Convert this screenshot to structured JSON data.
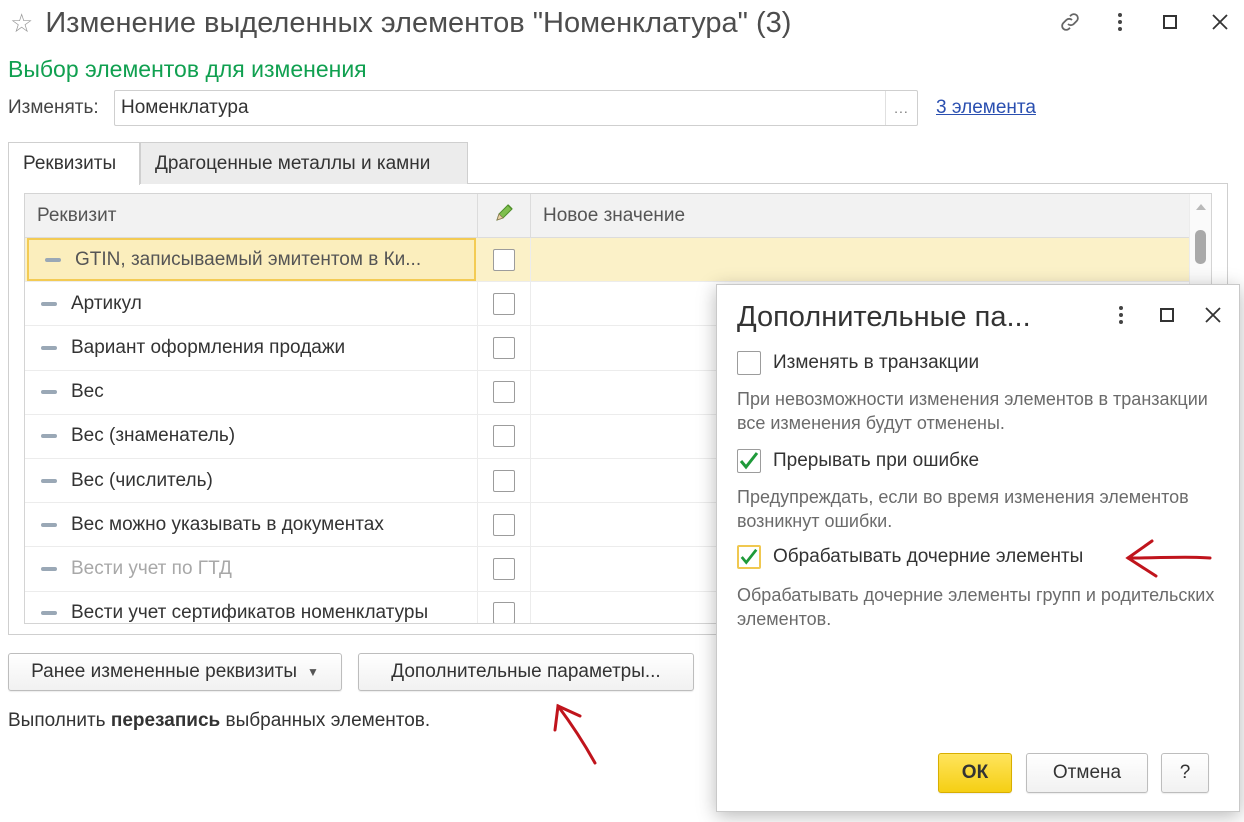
{
  "window": {
    "title": "Изменение выделенных элементов \"Номенклатура\" (3)"
  },
  "section": {
    "title": "Выбор элементов для изменения"
  },
  "change": {
    "label": "Изменять:",
    "value": "Номенклатура",
    "choose_button": "...",
    "count_link": "3 элемента"
  },
  "tabs": [
    {
      "label": "Реквизиты",
      "active": true
    },
    {
      "label": "Драгоценные металлы и камни",
      "active": false
    }
  ],
  "table": {
    "columns": {
      "name": "Реквизит",
      "value": "Новое значение"
    },
    "rows": [
      {
        "label": "GTIN, записываемый эмитентом в Ки..."
      },
      {
        "label": "Артикул"
      },
      {
        "label": "Вариант оформления продажи"
      },
      {
        "label": "Вес"
      },
      {
        "label": "Вес (знаменатель)"
      },
      {
        "label": "Вес (числитель)"
      },
      {
        "label": "Вес можно указывать в документах"
      },
      {
        "label": "Вести учет по ГТД"
      },
      {
        "label": "Вести учет сертификатов номенклатуры"
      }
    ]
  },
  "buttons": {
    "previous": "Ранее измененные реквизиты",
    "more": "Дополнительные параметры..."
  },
  "footer": {
    "before": "Выполнить ",
    "bold": "перезапись",
    "after": " выбранных элементов."
  },
  "popup": {
    "title": "Дополнительные па...",
    "options": [
      {
        "label": "Изменять в транзакции",
        "checked": false,
        "description": "При невозможности изменения элементов в транзакции все изменения будут отменены."
      },
      {
        "label": "Прерывать при ошибке",
        "checked": true,
        "description": "Предупреждать, если во время изменения элементов возникнут ошибки."
      },
      {
        "label": "Обрабатывать дочерние элементы",
        "checked": true,
        "description": "Обрабатывать дочерние элементы групп и родительских элементов."
      }
    ],
    "ok": "ОК",
    "cancel": "Отмена",
    "help": "?"
  },
  "colors": {
    "accent_green": "#10a050",
    "link_blue": "#2a4fb0",
    "selection_yellow": "#fbf1c8",
    "ok_yellow": "#f5cf14",
    "check_green": "#1f9a3a",
    "annotation_red": "#c0141c"
  },
  "icons": [
    "star-icon",
    "link-icon",
    "more-vertical-icon",
    "maximize-icon",
    "close-icon",
    "pencil-icon",
    "dash-icon",
    "check-icon",
    "dropdown-caret-icon"
  ]
}
